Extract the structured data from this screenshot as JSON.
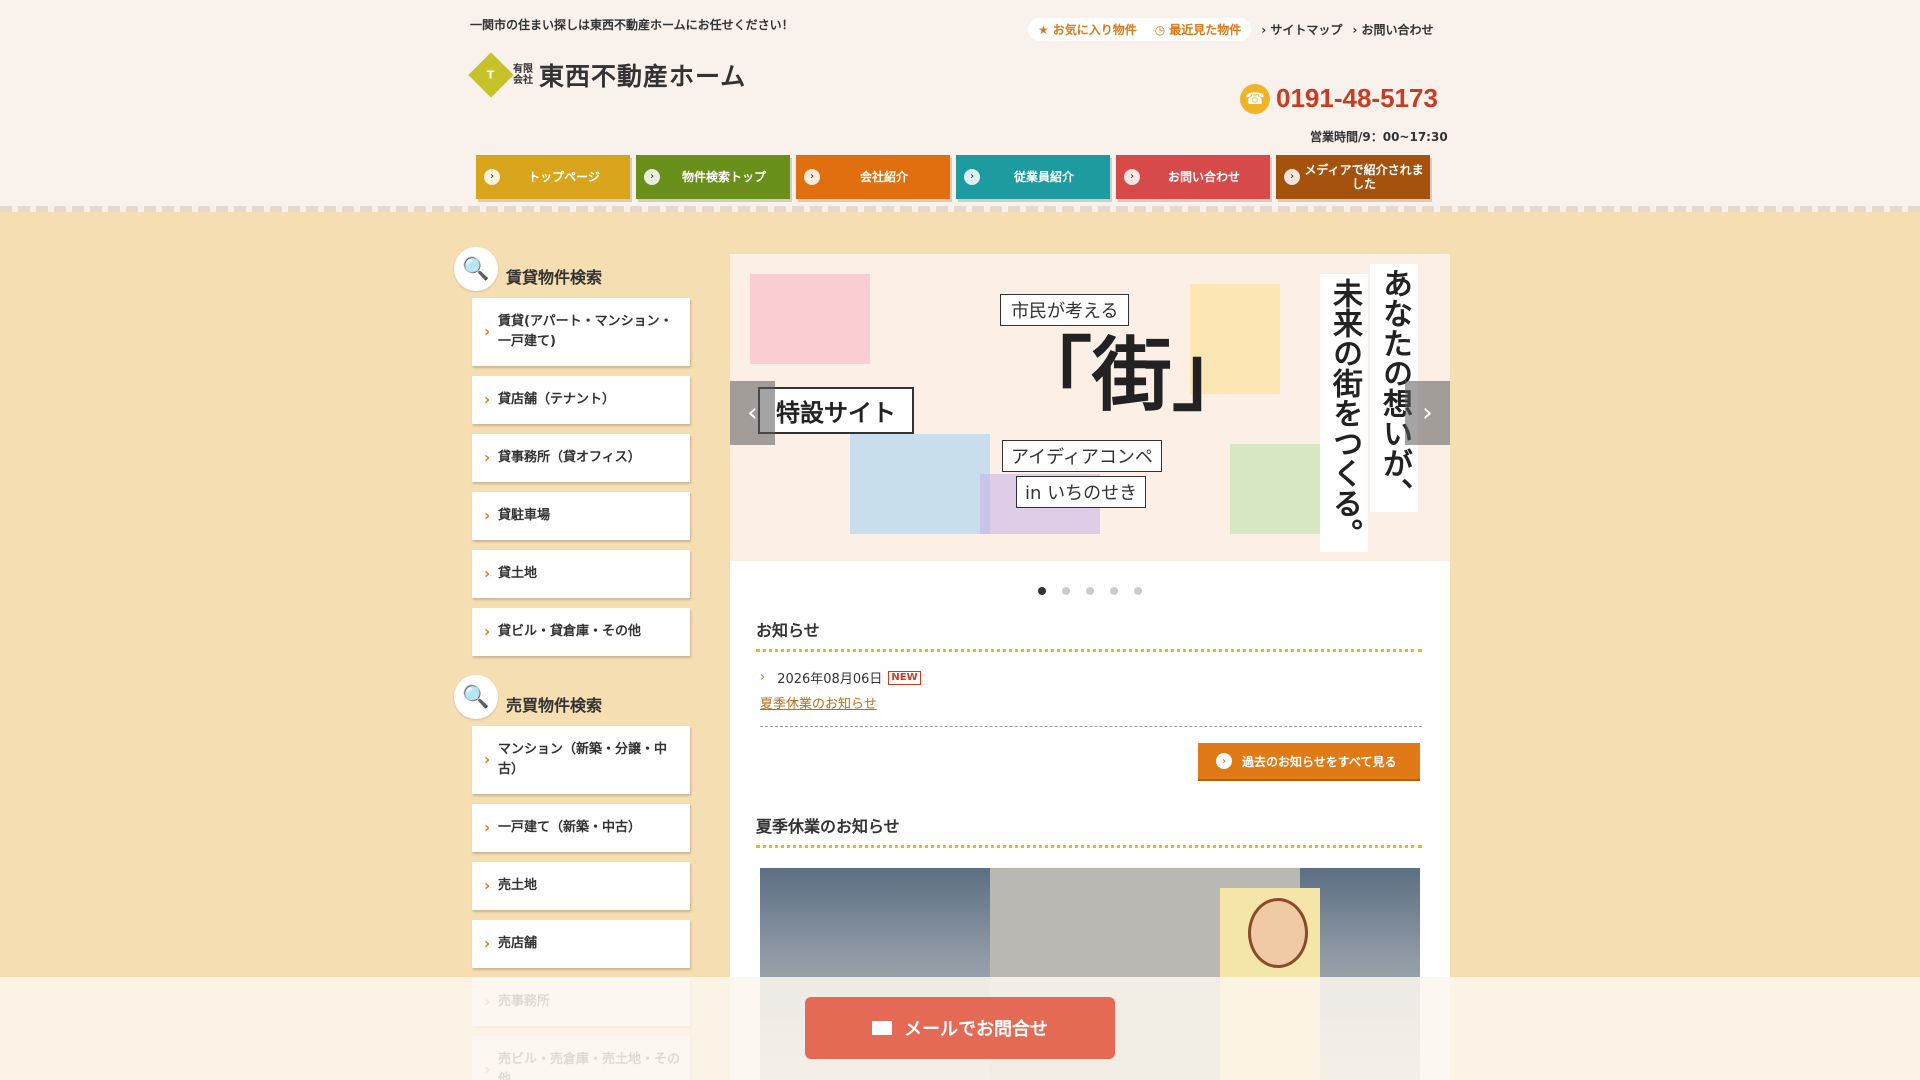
{
  "header": {
    "tagline": "一関市の住まい探しは東西不動産ホームにお任せください！",
    "logo_mark": "T",
    "logo_sub1": "有限",
    "logo_sub2": "会社",
    "logo_name": "東西不動産ホーム",
    "favorites": "お気に入り物件",
    "recent": "最近見た物件",
    "sitemap": "サイトマップ",
    "contact": "お問い合わせ",
    "tel": "0191-48-5173",
    "hours": "営業時間/9：00~17:30"
  },
  "nav": [
    {
      "label": "トップページ",
      "color": "#d9a51c"
    },
    {
      "label": "物件検索トップ",
      "color": "#6a8f1a"
    },
    {
      "label": "会社紹介",
      "color": "#e0700f"
    },
    {
      "label": "従業員紹介",
      "color": "#1e9aa1"
    },
    {
      "label": "お問い合わせ",
      "color": "#d64a4a"
    },
    {
      "label": "メディアで紹介されました",
      "color": "#a5520f"
    }
  ],
  "sidebar": {
    "rent_title": "賃貸物件検索",
    "rent_items": [
      "賃貸(アパート・マンション・一戸建て)",
      "貸店舗（テナント）",
      "貸事務所（貸オフィス）",
      "貸駐車場",
      "貸土地",
      "貸ビル・貸倉庫・その他"
    ],
    "sale_title": "売買物件検索",
    "sale_items": [
      "マンション（新築・分譲・中古）",
      "一戸建て（新築・中古）",
      "売土地",
      "売店舗",
      "売事務所",
      "売ビル・売倉庫・売土地・その他"
    ]
  },
  "slider": {
    "badge": "特設サイト",
    "ctitle": "市民が考える",
    "big": "「街」",
    "idea": "アイディアコンペ",
    "in": "in いちのせき",
    "vert1": "あなたの想いが、",
    "vert2": "未来の街をつくる。",
    "prev": "‹",
    "next": "›"
  },
  "news": {
    "title": "お知らせ",
    "date": "2026年08月06日",
    "new_badge": "NEW",
    "link": "夏季休業のお知らせ",
    "more": "過去のお知らせをすべて見る"
  },
  "article": {
    "title": "夏季休業のお知らせ"
  },
  "footer": {
    "mail_button": "メールでお問合せ"
  }
}
